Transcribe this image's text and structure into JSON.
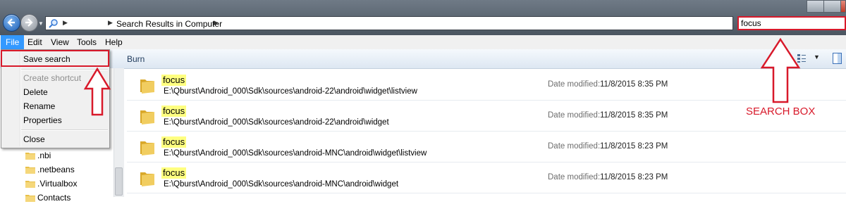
{
  "address_bar": {
    "path": "Search Results in Computer"
  },
  "search": {
    "query": "focus"
  },
  "menubar": {
    "items": [
      "File",
      "Edit",
      "View",
      "Tools",
      "Help"
    ]
  },
  "file_menu": {
    "save_search": "Save search",
    "create_shortcut": "Create shortcut",
    "delete": "Delete",
    "rename": "Rename",
    "properties": "Properties",
    "close": "Close"
  },
  "command_bar": {
    "burn": "Burn"
  },
  "nav_tree": [
    {
      "label": ".nbi"
    },
    {
      "label": ".netbeans"
    },
    {
      "label": ".Virtualbox"
    },
    {
      "label": "Contacts"
    }
  ],
  "results": [
    {
      "name": "focus",
      "path": "E:\\Qburst\\Android_000\\Sdk\\sources\\android-22\\android\\widget\\listview",
      "date_label": "Date modified:",
      "date": "11/8/2015 8:35 PM"
    },
    {
      "name": "focus",
      "path": "E:\\Qburst\\Android_000\\Sdk\\sources\\android-22\\android\\widget",
      "date_label": "Date modified:",
      "date": "11/8/2015 8:35 PM"
    },
    {
      "name": "focus",
      "path": "E:\\Qburst\\Android_000\\Sdk\\sources\\android-MNC\\android\\widget\\listview",
      "date_label": "Date modified:",
      "date": "11/8/2015 8:23 PM"
    },
    {
      "name": "focus",
      "path": "E:\\Qburst\\Android_000\\Sdk\\sources\\android-MNC\\android\\widget",
      "date_label": "Date modified:",
      "date": "11/8/2015 8:23 PM"
    }
  ],
  "annotation": {
    "search_box_label": "SEARCH BOX",
    "color": "#d8192a"
  },
  "colors": {
    "highlight": "#ffff80",
    "menu_active": "#3399ff"
  }
}
